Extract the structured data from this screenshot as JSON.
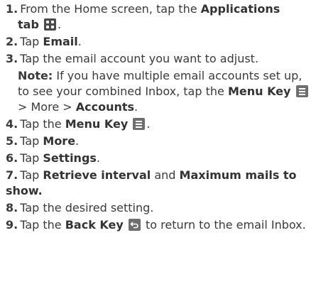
{
  "steps": [
    {
      "num": "1.",
      "parts": [
        "From the Home screen, tap the ",
        "Applications",
        "tab",
        "."
      ]
    },
    {
      "num": "2.",
      "parts": [
        "Tap ",
        "Email",
        "."
      ]
    },
    {
      "num": "3.",
      "parts": [
        "Tap the email account you want to adjust."
      ],
      "note": {
        "label": "Note:",
        "text": " If you have multiple email accounts set up, to see your combined Inbox, tap the ",
        "menu_key": "Menu Key",
        "more": " > More > ",
        "accounts": "Accounts",
        "end": "."
      }
    },
    {
      "num": "4.",
      "parts": [
        "Tap the ",
        "Menu Key",
        "."
      ]
    },
    {
      "num": "5.",
      "parts": [
        "Tap ",
        "More",
        "."
      ]
    },
    {
      "num": "6.",
      "parts": [
        "Tap ",
        "Settings",
        "."
      ]
    },
    {
      "num": "7.",
      "parts": [
        "Tap ",
        "Retrieve interval",
        " and ",
        "Maximum mails to show."
      ]
    },
    {
      "num": "8.",
      "parts": [
        "Tap the desired setting."
      ]
    },
    {
      "num": "9.",
      "parts": [
        "Tap the ",
        "Back Key",
        " to return to the email Inbox."
      ]
    }
  ],
  "icons": {
    "applications": "applications-grid-icon",
    "menu": "menu-key-icon",
    "back": "back-key-icon"
  }
}
